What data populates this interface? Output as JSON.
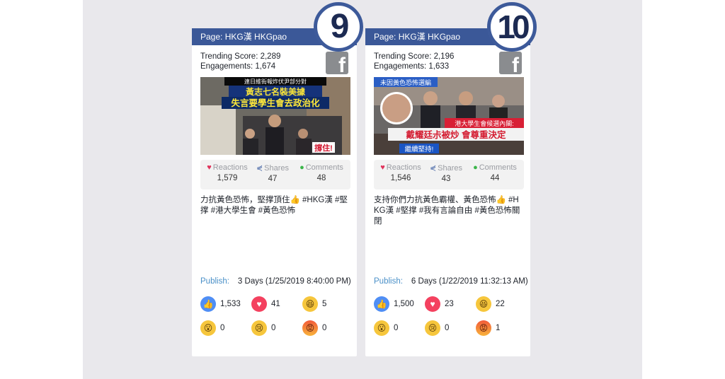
{
  "cards": [
    {
      "rank": "9",
      "page": "Page: HKG漢 HKGpao",
      "trending": "Trending Score: 2,289",
      "engagements": "Engagements: 1,674",
      "fb_icon": "facebook-icon",
      "thumb_texts": [
        "連日維街報炸伏尹部分對",
        "黃志七名裝美據",
        "失言要學生會去政治化",
        "撐住!"
      ],
      "reactions_label": "Reactions",
      "reactions_value": "1,579",
      "shares_label": "Shares",
      "shares_value": "47",
      "comments_label": "Comments",
      "comments_value": "48",
      "post_text": "力抗黃色恐怖，堅撑頂住👍 #HKG漢 #堅撑 #港大學生會 #黃色恐怖",
      "publish_label": "Publish:",
      "publish_value": "3 Days (1/25/2019 8:40:00 PM)",
      "like": "1,533",
      "love": "41",
      "haha": "5",
      "wow": "0",
      "sad": "0",
      "angry": "0"
    },
    {
      "rank": "10",
      "page": "Page: HKG漢 HKGpao",
      "trending": "Trending Score: 2,196",
      "engagements": "Engagements: 1,633",
      "fb_icon": "facebook-icon",
      "thumb_texts": [
        "未因黃色恐怖選編",
        "港大學生會候選內閣:",
        "戴耀廷尗被炒 會尊重決定",
        "繼續堅持!"
      ],
      "reactions_label": "Reactions",
      "reactions_value": "1,546",
      "shares_label": "Shares",
      "shares_value": "43",
      "comments_label": "Comments",
      "comments_value": "44",
      "post_text": "支持你們力抗黃色霸權、黃色恐怖👍 #HKG漢 #堅撑 #我有言論自由 #黃色恐怖關閉",
      "publish_label": "Publish:",
      "publish_value": "6 Days (1/22/2019 11:32:13 AM)",
      "like": "1,500",
      "love": "23",
      "haha": "22",
      "wow": "0",
      "sad": "0",
      "angry": "1"
    }
  ],
  "colors": {
    "header": "#3b5898",
    "rank_border": "#3d5a9a",
    "publish_label": "#4a90c8",
    "background": "#e9e8ec"
  }
}
